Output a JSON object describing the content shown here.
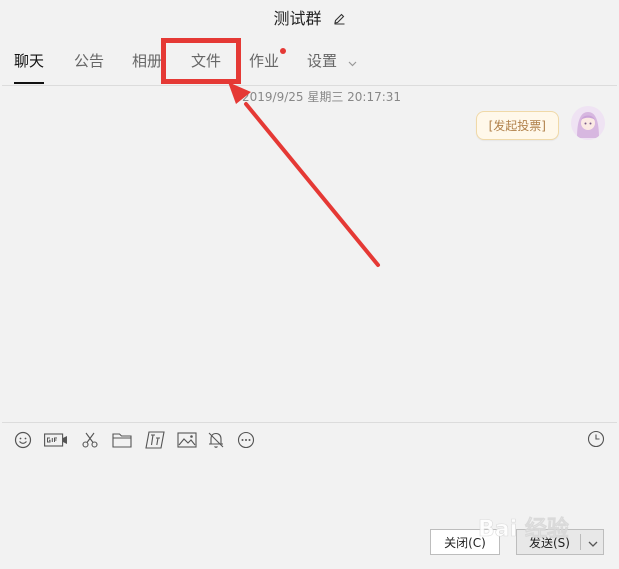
{
  "window": {
    "title": "测试群"
  },
  "tabs": [
    {
      "label": "聊天",
      "active": true
    },
    {
      "label": "公告"
    },
    {
      "label": "相册"
    },
    {
      "label": "文件"
    },
    {
      "label": "作业",
      "badge": true
    },
    {
      "label": "设置",
      "has_dropdown": true
    }
  ],
  "chat": {
    "timestamp": "2019/9/25 星期三 20:17:31",
    "messages": [
      {
        "text": "[发起投票]",
        "from": "self"
      }
    ]
  },
  "toolbar": {
    "icons": [
      "emoji-icon",
      "gif-icon",
      "scissors-icon",
      "folder-icon",
      "font-icon",
      "image-icon",
      "bell-icon",
      "more-icon"
    ],
    "history_icon": "clock-icon"
  },
  "buttons": {
    "close_label": "关闭(C)",
    "send_label": "发送(S)"
  },
  "watermark": {
    "text": "Bai 经验"
  },
  "colors": {
    "annotation": "#e53935",
    "badge": "#e53935",
    "background": "#f2f2f2"
  }
}
